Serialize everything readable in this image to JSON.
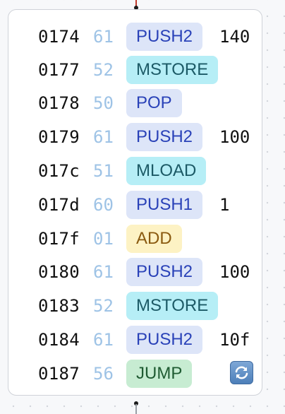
{
  "block": {
    "rows": [
      {
        "addr": "0174",
        "hex": "61",
        "op": "PUSH2",
        "kind": "push",
        "arg": "140"
      },
      {
        "addr": "0177",
        "hex": "52",
        "op": "MSTORE",
        "kind": "mem",
        "arg": ""
      },
      {
        "addr": "0178",
        "hex": "50",
        "op": "POP",
        "kind": "push",
        "arg": ""
      },
      {
        "addr": "0179",
        "hex": "61",
        "op": "PUSH2",
        "kind": "push",
        "arg": "100"
      },
      {
        "addr": "017c",
        "hex": "51",
        "op": "MLOAD",
        "kind": "mem",
        "arg": ""
      },
      {
        "addr": "017d",
        "hex": "60",
        "op": "PUSH1",
        "kind": "push",
        "arg": "1"
      },
      {
        "addr": "017f",
        "hex": "01",
        "op": "ADD",
        "kind": "add",
        "arg": ""
      },
      {
        "addr": "0180",
        "hex": "61",
        "op": "PUSH2",
        "kind": "push",
        "arg": "100"
      },
      {
        "addr": "0183",
        "hex": "52",
        "op": "MSTORE",
        "kind": "mem",
        "arg": ""
      },
      {
        "addr": "0184",
        "hex": "61",
        "op": "PUSH2",
        "kind": "push",
        "arg": "10f"
      },
      {
        "addr": "0187",
        "hex": "56",
        "op": "JUMP",
        "kind": "jump",
        "arg": ""
      }
    ],
    "loop_icon": "loop-arrows-icon"
  },
  "colors": {
    "push": "#dde5f8",
    "memory": "#b6eef6",
    "arith": "#fdf2c4",
    "jump": "#c7ecd2",
    "hex_text": "#9ec3e6"
  }
}
